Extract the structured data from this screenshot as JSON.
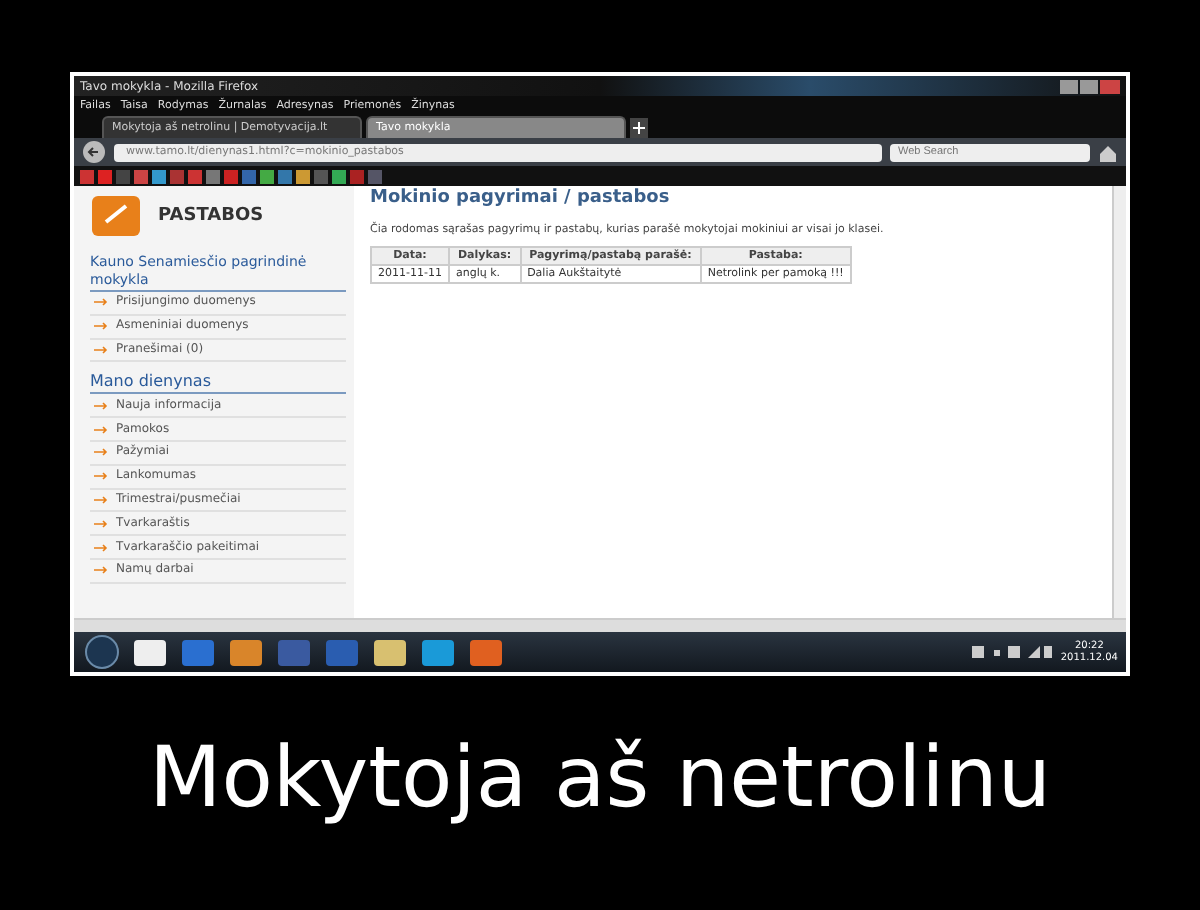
{
  "browser": {
    "title": "Tavo mokykla - Mozilla Firefox",
    "menu": [
      "Failas",
      "Taisa",
      "Rodymas",
      "Žurnalas",
      "Adresynas",
      "Priemonės",
      "Žinynas"
    ],
    "tabs": [
      {
        "label": "Mokytoja aš netrolinu | Demotyvacija.lt",
        "selected": false
      },
      {
        "label": "Tavo mokykla",
        "selected": true
      }
    ],
    "url": "www.tamo.lt/dienynas1.html?c=mokinio_pastabos",
    "search_placeholder": "Web Search"
  },
  "sidebar": {
    "logo_label": "PASTABOS",
    "school": "Kauno Senamiesčio pagrindinė mokykla",
    "school_links": [
      "Prisijungimo duomenys",
      "Asmeniniai duomenys",
      "Pranešimai (0)"
    ],
    "section": "Mano dienynas",
    "section_links": [
      "Nauja informacija",
      "Pamokos",
      "Pažymiai",
      "Lankomumas",
      "Trimestrai/pusmečiai",
      "Tvarkaraštis",
      "Tvarkaraščio pakeitimai",
      "Namų darbai"
    ]
  },
  "main": {
    "heading": "Mokinio pagyrimai / pastabos",
    "intro": "Čia rodomas sąrašas pagyrimų ir pastabų, kurias parašė mokytojai mokiniui ar visai jo klasei.",
    "table": {
      "columns": [
        "Data:",
        "Dalykas:",
        "Pagyrimą/pastabą parašė:",
        "Pastaba:"
      ],
      "rows": [
        [
          "2011-11-11",
          "anglų k.",
          "Dalia Aukštaitytė",
          "Netrolink per pamoką !!!"
        ]
      ]
    }
  },
  "taskbar": {
    "time": "20:22",
    "date": "2011.12.04"
  },
  "caption": "Mokytoja aš netrolinu"
}
